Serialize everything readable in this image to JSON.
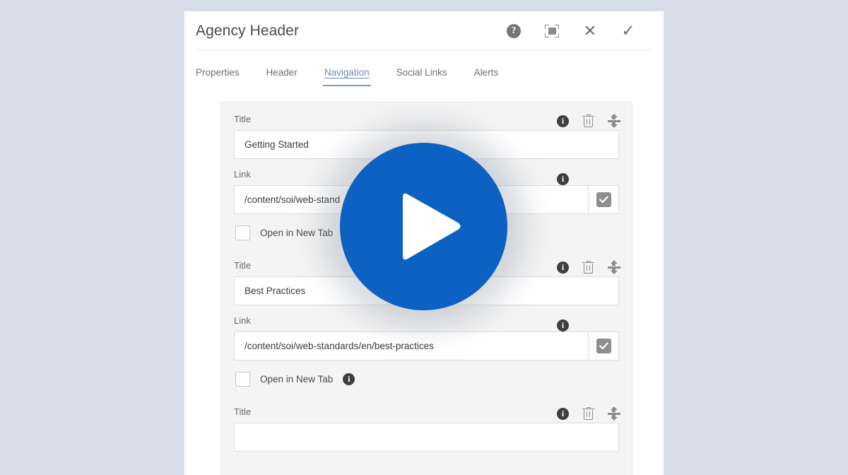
{
  "window": {
    "title": "Agency Header",
    "actions": [
      {
        "name": "help-icon",
        "label": "Help"
      },
      {
        "name": "fullscreen-icon",
        "label": "Fullscreen"
      },
      {
        "name": "close-icon",
        "label": "Close"
      },
      {
        "name": "confirm-icon",
        "label": "Done"
      }
    ]
  },
  "tabs": [
    {
      "label": "Properties",
      "active": false
    },
    {
      "label": "Header",
      "active": false
    },
    {
      "label": "Navigation",
      "active": true
    },
    {
      "label": "Social Links",
      "active": false
    },
    {
      "label": "Alerts",
      "active": false
    }
  ],
  "form": {
    "labels": {
      "title": "Title",
      "link": "Link",
      "open_in_new_tab": "Open in New Tab"
    },
    "groups": [
      {
        "title_value": "Getting Started",
        "link_value": "/content/soi/web-standards/en/getting-started",
        "link_value_visible": "/content/soi/web-stand",
        "open_in_new_tab": false
      },
      {
        "title_value": "Best Practices",
        "link_value": "/content/soi/web-standards/en/best-practices",
        "link_value_visible": "/content/soi/web-standards/en/best-practices",
        "open_in_new_tab": false
      },
      {
        "title_value": "",
        "link_value": "",
        "link_value_visible": "",
        "open_in_new_tab": false
      }
    ],
    "row_tools": [
      {
        "name": "info-icon",
        "glyph": "i"
      },
      {
        "name": "delete-icon",
        "label": "Delete"
      },
      {
        "name": "reorder-handle",
        "label": "Reorder"
      }
    ]
  },
  "overlay": {
    "play_button_label": "Play",
    "color": "#0c61c2"
  },
  "colors": {
    "page_background": "#d7dde8",
    "dialog_background": "#ffffff",
    "panel_background": "#f4f4f4",
    "accent": "#8299bf",
    "play_blue": "#0c61c2"
  }
}
